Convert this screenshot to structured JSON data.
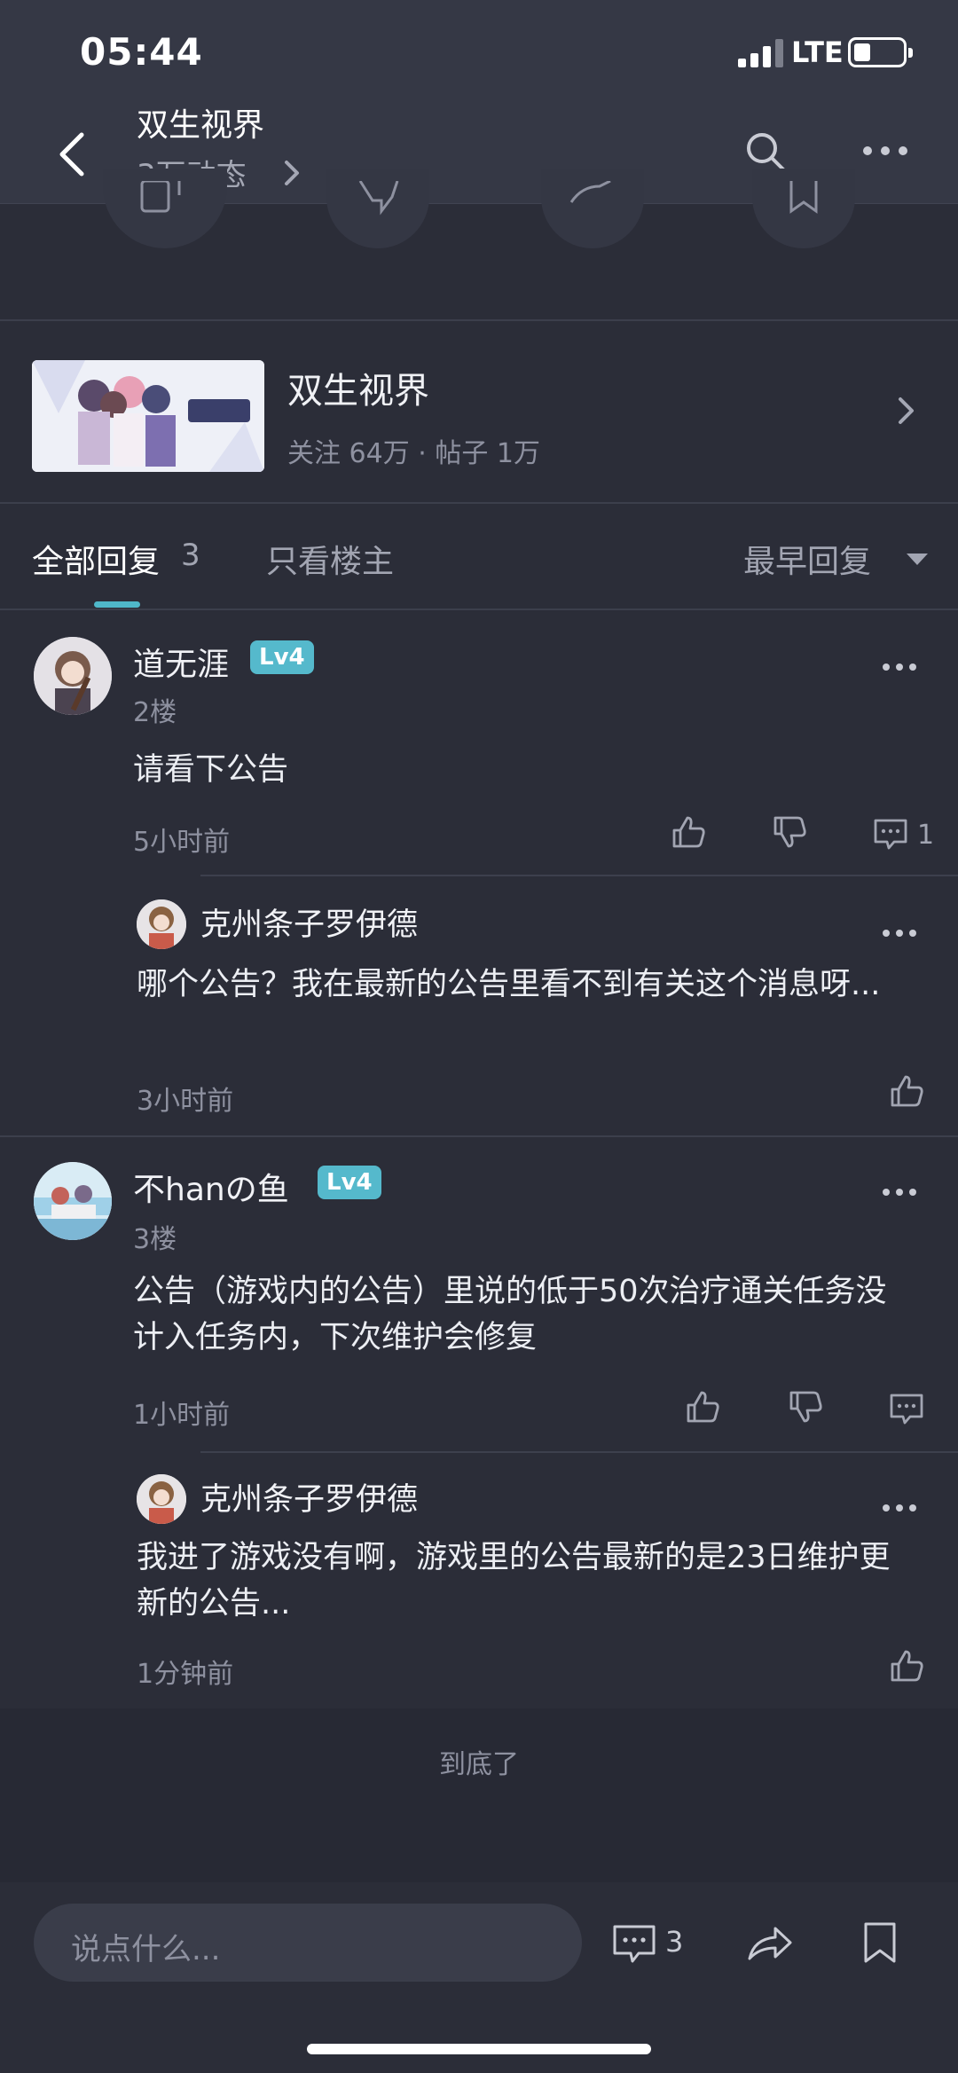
{
  "status": {
    "time": "05:44",
    "network": "LTE"
  },
  "header": {
    "title": "双生视界",
    "subtitle": "3万动态"
  },
  "forum": {
    "name": "双生视界",
    "meta": "关注 64万 · 帖子 1万"
  },
  "tabs": {
    "all": "全部回复",
    "all_count": "3",
    "owner_only": "只看楼主",
    "sort": "最早回复"
  },
  "comments": [
    {
      "username": "道无涯",
      "level": "Lv4",
      "floor": "2楼",
      "text": "请看下公告",
      "time": "5小时前",
      "reply_count": "1",
      "reply": {
        "username": "克州条子罗伊德",
        "text": "哪个公告？我在最新的公告里看不到有关这个消息呀...",
        "time": "3小时前"
      }
    },
    {
      "username": "不hanの鱼",
      "level": "Lv4",
      "floor": "3楼",
      "text": "公告（游戏内的公告）里说的低于50次治疗通关任务没计入任务内，下次维护会修复",
      "time": "1小时前",
      "reply": {
        "username": "克州条子罗伊德",
        "text": "我进了游戏没有啊，游戏里的公告最新的是23日维护更新的公告...",
        "time": "1分钟前"
      }
    }
  ],
  "end_text": "到底了",
  "bottom": {
    "input_placeholder": "说点什么...",
    "comment_count": "3"
  },
  "colors": {
    "background": "#2b2d38",
    "header": "#353845",
    "accent": "#4fb7c9",
    "level_badge": "#55b9cc"
  }
}
